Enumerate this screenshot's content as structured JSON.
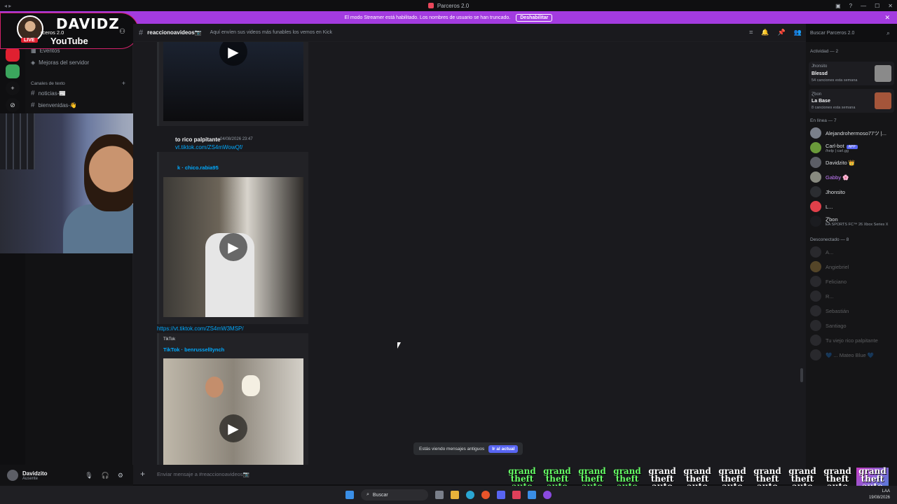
{
  "window": {
    "title": "Parceros 2.0"
  },
  "notice": {
    "text": "El modo Streamer está habilitado. Los nombres de usuario se han truncado.",
    "button": "Deshabilitar"
  },
  "overlay": {
    "name": "DAVIDZ",
    "platform": "YouTube",
    "live": "LIVE",
    "server_label": "rceros 2.0"
  },
  "sidebar": {
    "items": [
      {
        "label": "Eventos",
        "icon": "calendar-icon"
      },
      {
        "label": "Mejoras del servidor",
        "icon": "boost-icon"
      }
    ],
    "category": "Canales de texto",
    "channels": [
      {
        "label": "noticias-📰"
      },
      {
        "label": "bienvenidas-👋"
      }
    ]
  },
  "channel": {
    "name": "reaccionoavideos📷",
    "topic": "Aquí envíen sus videos más funables los vemos en Kick"
  },
  "search": {
    "placeholder": "Buscar Parceros 2.0"
  },
  "messages": {
    "author": "to rico palpitante",
    "timestamp": "04/08/2026 23:47",
    "link1": "vt.tiktok.com/ZS4mWowQf/",
    "embed1_title": "k · chico.rabia95",
    "link2": "https://vt.tiktok.com/ZS4mW3MSP/",
    "embed2_provider": "TikTok",
    "embed2_title": "TikTok · benrussellIynch"
  },
  "jump": {
    "text": "Estás viendo mensajes antiguos",
    "button": "Ir al actual"
  },
  "composer": {
    "placeholder": "Enviar mensaje a #reaccionoavideos📷"
  },
  "user": {
    "name": "Davidzito",
    "status": "Ausente"
  },
  "members": {
    "activity_header": "Actividad — 2",
    "activities": [
      {
        "user": "Jhonsito",
        "title": "Blessd",
        "sub": "54 canciones esta semana"
      },
      {
        "user": "Ɀbon",
        "title": "La Base",
        "sub": "8 canciones esta semana"
      }
    ],
    "online_header": "En línea — 7",
    "online": [
      {
        "name": "Alejandrohermoso77ツ |...",
        "sub": ""
      },
      {
        "name": "Carl-bot",
        "sub": "/help | carl.gg",
        "badge": "APP"
      },
      {
        "name": "Davidzito 👑",
        "sub": ""
      },
      {
        "name": "Gabby 🌸",
        "sub": ""
      },
      {
        "name": "Jhonsito",
        "sub": ""
      },
      {
        "name": "L...",
        "sub": ""
      },
      {
        "name": "Ɀbon",
        "sub": "EA SPORTS FC™ 26 Xbox Series X"
      }
    ],
    "offline_header": "Desconectado — 8",
    "offline": [
      {
        "name": "A..."
      },
      {
        "name": "Angiebriel"
      },
      {
        "name": "Feliciano"
      },
      {
        "name": "R..."
      },
      {
        "name": "Sebastián"
      },
      {
        "name": "Santiago"
      },
      {
        "name": "Tu viejo rico palpitante"
      },
      {
        "name": "💙 ... Mateo Blue 💙"
      }
    ]
  },
  "taskbar": {
    "search": "Buscar",
    "lang": "LAA",
    "date": "19/08/2026"
  },
  "gta_logo_text": "grand theft auto"
}
